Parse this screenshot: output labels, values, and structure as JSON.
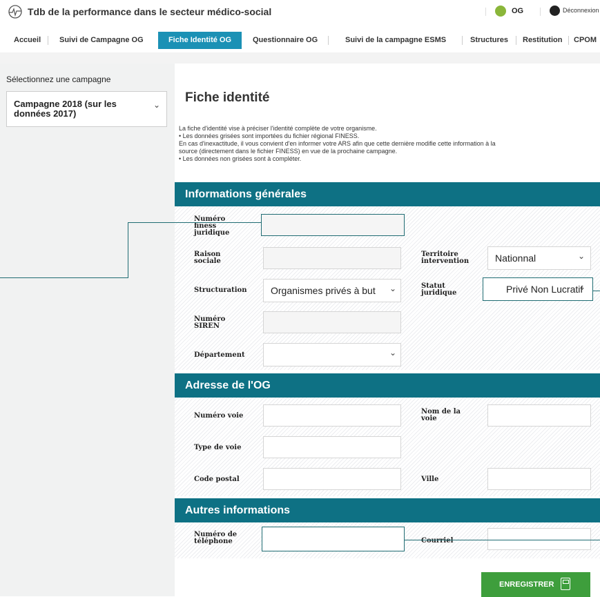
{
  "header": {
    "app_title": "Tdb de la performance dans le secteur médico-social",
    "user_label": "OG",
    "logout_label": "Déconnexion"
  },
  "nav": {
    "items": [
      "Accueil",
      "Suivi de Campagne OG",
      "Fiche Identité OG",
      "Questionnaire OG",
      "Suivi de la campagne ESMS",
      "Structures",
      "Restitution",
      "CPOM"
    ],
    "active": "Fiche Identité OG"
  },
  "sidebar": {
    "label": "Sélectionnez une campagne",
    "selected_campaign": "Campagne 2018 (sur les données 2017)"
  },
  "page": {
    "title": "Fiche identité",
    "intro": [
      "La fiche d'identité vise à préciser l'identité complète de votre organisme.",
      " •  Les données grisées sont importées du fichier régional FINESS.",
      "En cas d'inexactitude, il vous convient d'en informer votre ARS afin que cette dernière modifie cette information à la",
      "source (directement dans le fichier FINESS) en vue de la prochaine campagne.",
      " •  Les données non grisées sont à compléter."
    ]
  },
  "sections": {
    "general": {
      "title": "Informations générales",
      "finess_label": "Numéro finess juridique",
      "finess_value": "",
      "raison_label": "Raison sociale",
      "raison_value": "",
      "territoire_label": "Territoire intervention",
      "territoire_value": "Nationnal",
      "structuration_label": "Structuration",
      "structuration_value": "Organismes privés à but",
      "statut_label": "Statut juridique",
      "statut_value": "Privé Non Lucratif",
      "siren_label": "Numéro SIREN",
      "siren_value": "",
      "departement_label": "Département",
      "departement_value": ""
    },
    "address": {
      "title": "Adresse de l'OG",
      "numero_voie_label": "Numéro voie",
      "nom_voie_label": "Nom de la voie",
      "type_voie_label": "Type de voie",
      "code_postal_label": "Code postal",
      "ville_label": "Ville"
    },
    "other": {
      "title": "Autres informations",
      "telephone_label": "Numéro de téléphone",
      "courriel_label": "Courriel"
    }
  },
  "actions": {
    "save_label": "ENREGISTRER"
  },
  "colors": {
    "nav_active": "#1b91b5",
    "section_header": "#0e7184",
    "save_button": "#3e9e3c",
    "highlight_border": "#1e6b72"
  }
}
